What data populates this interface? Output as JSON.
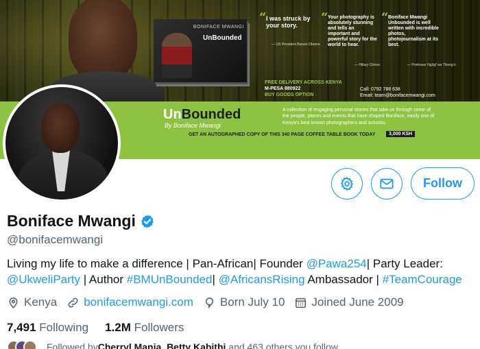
{
  "banner": {
    "book_author": "BONIFACE MWANGI",
    "book_title": "UnBounded",
    "quotes": [
      {
        "text": "I was struck by your story.",
        "attribution": "— US President Barack Obama"
      },
      {
        "text": "Your photography is absolutely stunning and tells an important and powerful story for the world to hear.",
        "attribution": "— Hillary Clinton"
      },
      {
        "text": "Boniface Mwangi Unbounded is well written with incredible photos, photojournalism at its best.",
        "attribution": "— Professor Ngũgĩ wa Thiong'o"
      }
    ],
    "promo_line_1": "FREE DELIVERY ACROSS KENYA",
    "promo_line_2": "M-PESA 880922",
    "promo_line_3": "BUY GOODS OPTION",
    "contact_call": "Call: 0792 788 638",
    "contact_email": "Email: team@bonifacemwangi.com",
    "brand_un": "Un",
    "brand_bounded": "Bounded",
    "brand_byline": "By Boniface Mwangi",
    "brand_description": "A collection of engaging personal stories that take us through some of the people, places and events that have shaped Boniface, easily one of Kenya's best known photographers and activists.",
    "autograph_text": "GET AN AUTOGRAPHED COPY OF THIS 340 PAGE COFFEE TABLE BOOK TODAY",
    "price": "3,000 KSH",
    "accent_green": "#8cc341"
  },
  "profile": {
    "display_name": "Boniface Mwangi",
    "handle": "@bonifacemwangi",
    "verified": true,
    "follow_label": "Follow",
    "bio": {
      "t1": "Living my life to make a difference | Pan-African| Founder ",
      "m1": "@Pawa254",
      "t2": "| Party Leader: ",
      "m2": "@UkweliParty",
      "t3": " | Author ",
      "m3": "#BMUnBounded",
      "t4": "| ",
      "m4": "@AfricansRising",
      "t5": " Ambassador | ",
      "m5": "#TeamCourage"
    },
    "location": "Kenya",
    "website": "bonifacemwangi.com",
    "birthday": "Born July 10",
    "joined": "Joined June 2009",
    "following_count": "7,491",
    "following_label": "Following",
    "followers_count": "1.2M",
    "followers_label": "Followers",
    "followed_by_prefix": "Followed by ",
    "followed_by_names": "Cherryl Manja, Betty Kabithi,",
    "followed_by_suffix": " and 463 others you follow",
    "link_color": "#1d9bf0"
  }
}
